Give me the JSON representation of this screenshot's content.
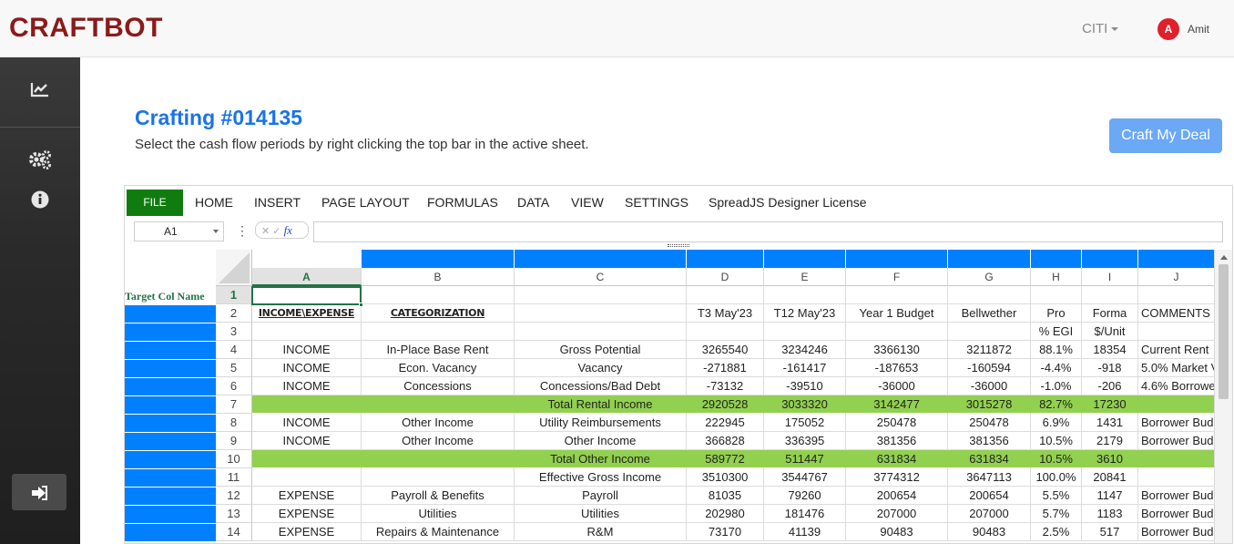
{
  "brand": "CRAFTBOT",
  "org": "CITI",
  "user": {
    "initial": "A",
    "name": "Amit"
  },
  "page": {
    "title": "Crafting #014135",
    "subtitle": "Select the cash flow periods by right clicking the top bar in the active sheet.",
    "craft_button": "Craft My Deal"
  },
  "sidebar": {
    "icons": [
      "chart-line-icon",
      "gears-icon",
      "info-circle-icon",
      "logout-icon"
    ]
  },
  "ribbon": {
    "file": "FILE",
    "tabs": [
      "HOME",
      "INSERT",
      "PAGE LAYOUT",
      "FORMULAS",
      "DATA",
      "VIEW",
      "SETTINGS",
      "SpreadJS Designer License"
    ]
  },
  "formula_bar": {
    "name_box": "A1",
    "fx_label": "fx",
    "value": ""
  },
  "sheet": {
    "target_label": "Target Col Name",
    "columns": [
      "A",
      "B",
      "C",
      "D",
      "E",
      "F",
      "G",
      "H",
      "I",
      "J"
    ],
    "rows": [
      {
        "n": "1",
        "total": false,
        "cells": [
          "",
          "",
          "",
          "",
          "",
          "",
          "",
          "",
          "",
          ""
        ]
      },
      {
        "n": "2",
        "total": false,
        "cells": [
          "INCOME\\EXPENSE",
          "CATEGORIZATION",
          "",
          "T3 May'23",
          "T12 May'23",
          "Year 1 Budget",
          "Bellwether",
          "Pro",
          "Forma",
          "COMMENTS"
        ]
      },
      {
        "n": "3",
        "total": false,
        "cells": [
          "",
          "",
          "",
          "",
          "",
          "",
          "",
          "% EGI",
          "$/Unit",
          ""
        ]
      },
      {
        "n": "4",
        "total": false,
        "cells": [
          "INCOME",
          "In-Place Base Rent",
          "Gross Potential",
          "3265540",
          "3234246",
          "3366130",
          "3211872",
          "88.1%",
          "18354",
          "Current Rent"
        ]
      },
      {
        "n": "5",
        "total": false,
        "cells": [
          "INCOME",
          "Econ. Vacancy",
          "Vacancy",
          "-271881",
          "-161417",
          "-187653",
          "-160594",
          "-4.4%",
          "-918",
          "5.0% Market V"
        ]
      },
      {
        "n": "6",
        "total": false,
        "cells": [
          "INCOME",
          "Concessions",
          "Concessions/Bad Debt",
          "-73132",
          "-39510",
          "-36000",
          "-36000",
          "-1.0%",
          "-206",
          "4.6% Borrowe"
        ]
      },
      {
        "n": "7",
        "total": true,
        "cells": [
          "",
          "",
          "Total Rental Income",
          "2920528",
          "3033320",
          "3142477",
          "3015278",
          "82.7%",
          "17230",
          ""
        ]
      },
      {
        "n": "8",
        "total": false,
        "cells": [
          "INCOME",
          "Other Income",
          "Utility Reimbursements",
          "222945",
          "175052",
          "250478",
          "250478",
          "6.9%",
          "1431",
          "Borrower Bud"
        ]
      },
      {
        "n": "9",
        "total": false,
        "cells": [
          "INCOME",
          "Other Income",
          "Other Income",
          "366828",
          "336395",
          "381356",
          "381356",
          "10.5%",
          "2179",
          "Borrower Bud"
        ]
      },
      {
        "n": "10",
        "total": true,
        "cells": [
          "",
          "",
          "Total Other Income",
          "589772",
          "511447",
          "631834",
          "631834",
          "10.5%",
          "3610",
          ""
        ]
      },
      {
        "n": "11",
        "total": false,
        "cells": [
          "",
          "",
          "Effective Gross Income",
          "3510300",
          "3544767",
          "3774312",
          "3647113",
          "100.0%",
          "20841",
          ""
        ]
      },
      {
        "n": "12",
        "total": false,
        "cells": [
          "EXPENSE",
          "Payroll & Benefits",
          "Payroll",
          "81035",
          "79260",
          "200654",
          "200654",
          "5.5%",
          "1147",
          "Borrower Bud"
        ]
      },
      {
        "n": "13",
        "total": false,
        "cells": [
          "EXPENSE",
          "Utilities",
          "Utilities",
          "202980",
          "181476",
          "207000",
          "207000",
          "5.7%",
          "1183",
          "Borrower Bud"
        ]
      },
      {
        "n": "14",
        "total": false,
        "cells": [
          "EXPENSE",
          "Repairs & Maintenance",
          "R&M",
          "73170",
          "41139",
          "90483",
          "90483",
          "2.5%",
          "517",
          "Borrower Bud"
        ]
      }
    ]
  }
}
